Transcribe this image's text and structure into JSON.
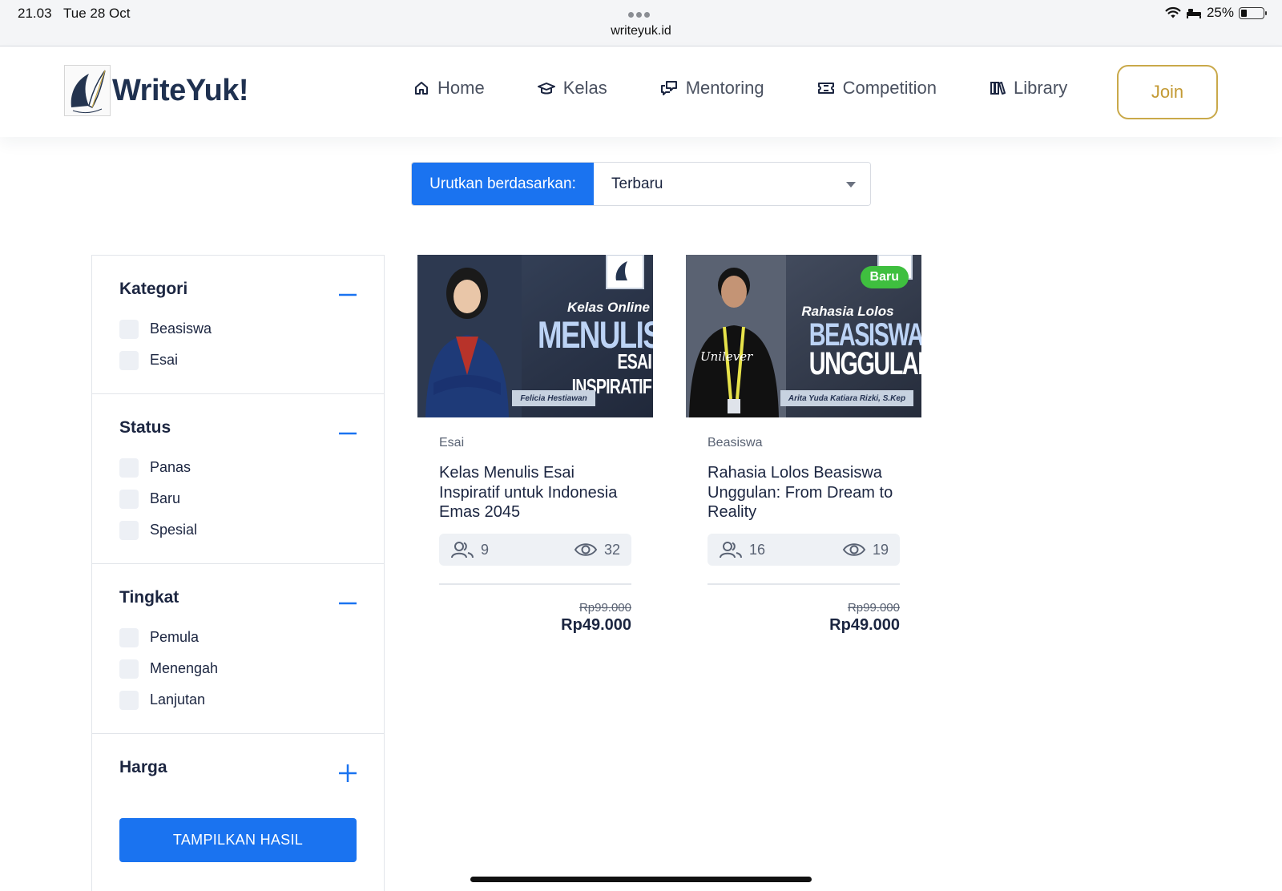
{
  "status_bar": {
    "time": "21.03",
    "date": "Tue 28 Oct",
    "url": "writeyuk.id",
    "battery": "25%",
    "battery_level": 0.25
  },
  "header": {
    "logo_text": "WriteYuk!",
    "nav": [
      {
        "label": "Home",
        "icon": "home-icon"
      },
      {
        "label": "Kelas",
        "icon": "graduation-cap-icon"
      },
      {
        "label": "Mentoring",
        "icon": "chat-bubbles-icon"
      },
      {
        "label": "Competition",
        "icon": "ticket-icon"
      },
      {
        "label": "Library",
        "icon": "books-icon"
      }
    ],
    "join_label": "Join"
  },
  "sort": {
    "label": "Urutkan berdasarkan:",
    "selected": "Terbaru"
  },
  "filters": {
    "sections": [
      {
        "title": "Kategori",
        "expanded": true,
        "options": [
          "Beasiswa",
          "Esai"
        ]
      },
      {
        "title": "Status",
        "expanded": true,
        "options": [
          "Panas",
          "Baru",
          "Spesial"
        ]
      },
      {
        "title": "Tingkat",
        "expanded": true,
        "options": [
          "Pemula",
          "Menengah",
          "Lanjutan"
        ]
      },
      {
        "title": "Harga",
        "expanded": false,
        "options": []
      }
    ],
    "submit_label": "TAMPILKAN HASIL"
  },
  "cards": [
    {
      "category": "Esai",
      "title": "Kelas Menulis Esai Inspiratif untuk Indonesia Emas 2045",
      "participants": "9",
      "views": "32",
      "old_price": "Rp99.000",
      "price": "Rp49.000",
      "banner": {
        "line1": "Kelas Online",
        "line2": "MENULIS",
        "line3": "ESAI INSPIRATIF",
        "author": "Felicia Hestiawan"
      },
      "badge": ""
    },
    {
      "category": "Beasiswa",
      "title": "Rahasia Lolos Beasiswa Unggulan: From Dream to Reality",
      "participants": "16",
      "views": "19",
      "old_price": "Rp99.000",
      "price": "Rp49.000",
      "banner": {
        "line1": "Rahasia Lolos",
        "line2": "BEASISWA",
        "line3": "UNGGULAN",
        "author": "Arita Yuda Katiara Rizki, S.Kep"
      },
      "badge": "Baru"
    }
  ],
  "colors": {
    "primary": "#1a73f0",
    "gold": "#c9a94a",
    "badge_green": "#3fbf3f",
    "navy": "#1b2540"
  }
}
